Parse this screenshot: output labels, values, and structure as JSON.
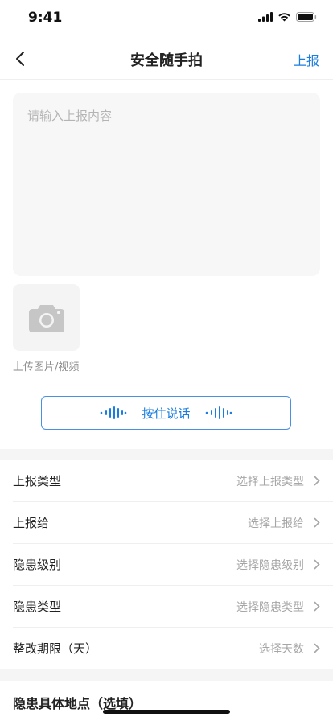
{
  "status_bar": {
    "time": "9:41"
  },
  "nav": {
    "title": "安全随手拍",
    "action": "上报"
  },
  "report": {
    "placeholder": "请输入上报内容"
  },
  "upload": {
    "label": "上传图片/视频"
  },
  "voice": {
    "label": "按住说话"
  },
  "form": {
    "rows": [
      {
        "label": "上报类型",
        "value": "选择上报类型"
      },
      {
        "label": "上报给",
        "value": "选择上报给"
      },
      {
        "label": "隐患级别",
        "value": "选择隐患级别"
      },
      {
        "label": "隐患类型",
        "value": "选择隐患类型"
      },
      {
        "label": "整改期限（天）",
        "value": "选择天数"
      }
    ]
  },
  "location": {
    "label": "隐患具体地点（选填）"
  },
  "colors": {
    "accent": "#1a7de0",
    "placeholder": "#b4b4b4",
    "background_gray": "#f7f7f7"
  }
}
